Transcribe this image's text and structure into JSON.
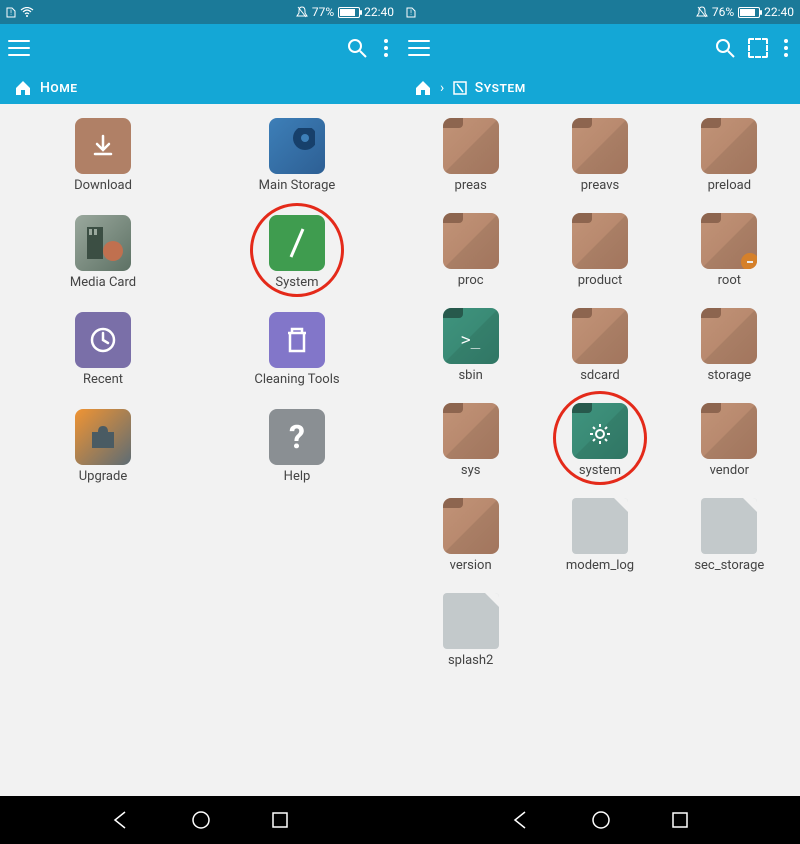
{
  "left": {
    "status": {
      "battery_pct": "77%",
      "time": "22:40"
    },
    "breadcrumb": {
      "home": "Home"
    },
    "items": [
      {
        "label": "Download",
        "icon": "download",
        "style": "brown"
      },
      {
        "label": "Main Storage",
        "icon": "mainstorage",
        "style": "blue"
      },
      {
        "label": "Media Card",
        "icon": "mediacard",
        "style": "media"
      },
      {
        "label": "System",
        "icon": "slash",
        "style": "green",
        "highlight": true
      },
      {
        "label": "Recent",
        "icon": "clock",
        "style": "purple"
      },
      {
        "label": "Cleaning Tools",
        "icon": "trash",
        "style": "violet"
      },
      {
        "label": "Upgrade",
        "icon": "puzzle",
        "style": "orange"
      },
      {
        "label": "Help",
        "icon": "question",
        "style": "grey"
      }
    ]
  },
  "right": {
    "status": {
      "battery_pct": "76%",
      "time": "22:40"
    },
    "breadcrumb": {
      "root": "System"
    },
    "items": [
      {
        "label": "preas",
        "style": "brown"
      },
      {
        "label": "preavs",
        "style": "brown"
      },
      {
        "label": "preload",
        "style": "brown"
      },
      {
        "label": "proc",
        "style": "brown"
      },
      {
        "label": "product",
        "style": "brown"
      },
      {
        "label": "root",
        "style": "brown",
        "badge": "minus"
      },
      {
        "label": "sbin",
        "style": "teal",
        "overlay": "terminal"
      },
      {
        "label": "sdcard",
        "style": "brown"
      },
      {
        "label": "storage",
        "style": "brown"
      },
      {
        "label": "sys",
        "style": "brown"
      },
      {
        "label": "system",
        "style": "teal",
        "overlay": "gear",
        "highlight": true
      },
      {
        "label": "vendor",
        "style": "brown"
      },
      {
        "label": "version",
        "style": "brown"
      },
      {
        "label": "modem_log",
        "style": "file"
      },
      {
        "label": "sec_storage",
        "style": "file"
      },
      {
        "label": "splash2",
        "style": "file"
      }
    ]
  }
}
